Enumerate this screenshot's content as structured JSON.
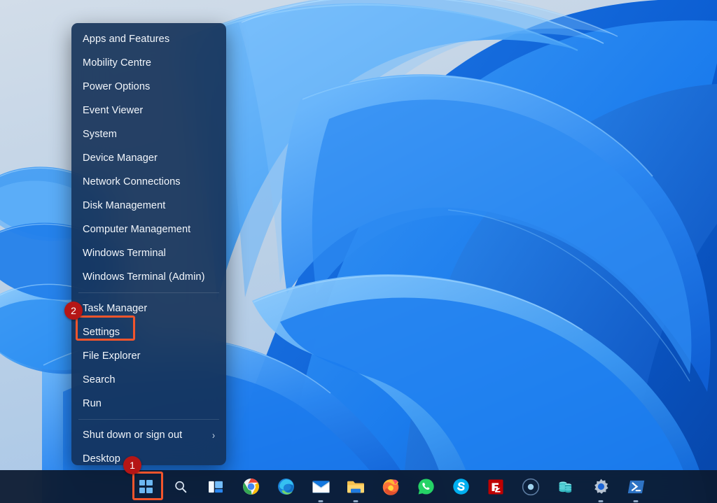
{
  "desktop": {
    "wallpaper_name": "windows-11-bloom-wallpaper",
    "sky_color": "#ccd9e8",
    "accent_blue": "#1277e8"
  },
  "winx_menu": {
    "name": "WinX power user menu",
    "background_color": "#133056",
    "items": [
      {
        "label": "Apps and Features",
        "has_submenu": false,
        "separator_after": false
      },
      {
        "label": "Mobility Centre",
        "has_submenu": false,
        "separator_after": false
      },
      {
        "label": "Power Options",
        "has_submenu": false,
        "separator_after": false
      },
      {
        "label": "Event Viewer",
        "has_submenu": false,
        "separator_after": false
      },
      {
        "label": "System",
        "has_submenu": false,
        "separator_after": false
      },
      {
        "label": "Device Manager",
        "has_submenu": false,
        "separator_after": false
      },
      {
        "label": "Network Connections",
        "has_submenu": false,
        "separator_after": false
      },
      {
        "label": "Disk Management",
        "has_submenu": false,
        "separator_after": false
      },
      {
        "label": "Computer Management",
        "has_submenu": false,
        "separator_after": false
      },
      {
        "label": "Windows Terminal",
        "has_submenu": false,
        "separator_after": false
      },
      {
        "label": "Windows Terminal (Admin)",
        "has_submenu": false,
        "separator_after": true
      },
      {
        "label": "Task Manager",
        "has_submenu": false,
        "separator_after": false
      },
      {
        "label": "Settings",
        "has_submenu": false,
        "separator_after": false
      },
      {
        "label": "File Explorer",
        "has_submenu": false,
        "separator_after": false
      },
      {
        "label": "Search",
        "has_submenu": false,
        "separator_after": false
      },
      {
        "label": "Run",
        "has_submenu": false,
        "separator_after": true
      },
      {
        "label": "Shut down or sign out",
        "has_submenu": true,
        "submenu_glyph": "›",
        "separator_after": false
      },
      {
        "label": "Desktop",
        "has_submenu": false,
        "separator_after": false
      }
    ]
  },
  "annotations": {
    "highlight_color": "#f2552c",
    "badge_color": "#b51616",
    "steps": [
      {
        "number": "1",
        "target": "start-button"
      },
      {
        "number": "2",
        "target": "menu-item-settings"
      }
    ]
  },
  "taskbar": {
    "background_color": "#0b192e",
    "buttons": [
      {
        "name": "start-button",
        "label": "Start",
        "icon": "windows-logo-icon",
        "running": false
      },
      {
        "name": "search-button",
        "label": "Search",
        "icon": "search-icon",
        "running": false
      },
      {
        "name": "task-view-button",
        "label": "Task View",
        "icon": "task-view-icon",
        "running": false
      },
      {
        "name": "chrome-button",
        "label": "Google Chrome",
        "icon": "chrome-icon",
        "running": true
      },
      {
        "name": "edge-button",
        "label": "Microsoft Edge",
        "icon": "edge-icon",
        "running": true
      },
      {
        "name": "mail-button",
        "label": "Mail",
        "icon": "mail-icon",
        "running": true
      },
      {
        "name": "file-explorer-button",
        "label": "File Explorer",
        "icon": "folder-icon",
        "running": true
      },
      {
        "name": "firefox-button",
        "label": "Firefox",
        "icon": "firefox-icon",
        "running": false
      },
      {
        "name": "whatsapp-button",
        "label": "WhatsApp",
        "icon": "whatsapp-icon",
        "running": false
      },
      {
        "name": "skype-button",
        "label": "Skype",
        "icon": "skype-icon",
        "running": false
      },
      {
        "name": "filezilla-button",
        "label": "FileZilla",
        "icon": "filezilla-icon",
        "running": false
      },
      {
        "name": "recorder-button",
        "label": "Recorder",
        "icon": "record-circle-icon",
        "running": false
      },
      {
        "name": "database-button",
        "label": "Database",
        "icon": "database-stack-icon",
        "running": false
      },
      {
        "name": "settings-button",
        "label": "Settings",
        "icon": "gear-icon",
        "running": true
      },
      {
        "name": "powershell-button",
        "label": "Windows PowerShell",
        "icon": "powershell-icon",
        "running": true
      }
    ]
  }
}
